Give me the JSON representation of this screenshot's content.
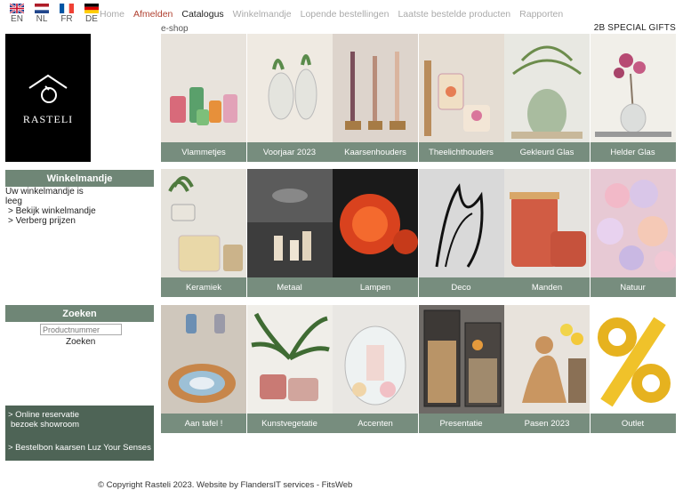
{
  "languages": [
    {
      "code": "EN",
      "flag": "uk"
    },
    {
      "code": "NL",
      "flag": "nl"
    },
    {
      "code": "FR",
      "flag": "fr"
    },
    {
      "code": "DE",
      "flag": "de"
    }
  ],
  "nav": {
    "home": "Home",
    "afmelden": "Afmelden",
    "catalogus": "Catalogus",
    "winkelmandje": "Winkelmandje",
    "lopende": "Lopende bestellingen",
    "laatste": "Laatste bestelde producten",
    "rapporten": "Rapporten"
  },
  "header": {
    "eshop": "e-shop",
    "gifts": "2B SPECIAL GIFTS"
  },
  "logo": {
    "text": "RASTELI"
  },
  "cart": {
    "title": "Winkelmandje",
    "empty_line1": "Uw winkelmandje is",
    "empty_line2": "leeg",
    "view_link": "> Bekijk winkelmandje",
    "hide_prices_link": "> Verberg prijzen"
  },
  "search": {
    "title": "Zoeken",
    "placeholder": "Productnummer",
    "button": "Zoeken"
  },
  "side_links": {
    "reservation_line1": "> Online reservatie",
    "reservation_line2": "bezoek showroom",
    "order_form": "> Bestelbon kaarsen Luz Your Senses"
  },
  "categories": [
    {
      "label": "Vlammetjes"
    },
    {
      "label": "Voorjaar 2023"
    },
    {
      "label": "Kaarsenhouders"
    },
    {
      "label": "Theelichthouders"
    },
    {
      "label": "Gekleurd Glas"
    },
    {
      "label": "Helder Glas"
    },
    {
      "label": "Keramiek"
    },
    {
      "label": "Metaal"
    },
    {
      "label": "Lampen"
    },
    {
      "label": "Deco"
    },
    {
      "label": "Manden"
    },
    {
      "label": "Natuur"
    },
    {
      "label": "Aan tafel !"
    },
    {
      "label": "Kunstvegetatie"
    },
    {
      "label": "Accenten"
    },
    {
      "label": "Presentatie"
    },
    {
      "label": "Pasen 2023"
    },
    {
      "label": "Outlet"
    }
  ],
  "footer": {
    "text": "© Copyright Rasteli 2023. Website by FlandersIT services - FitsWeb"
  },
  "colors": {
    "panel_green": "#6f8676",
    "dark_green": "#4e6456",
    "accent_red": "#b04030"
  }
}
